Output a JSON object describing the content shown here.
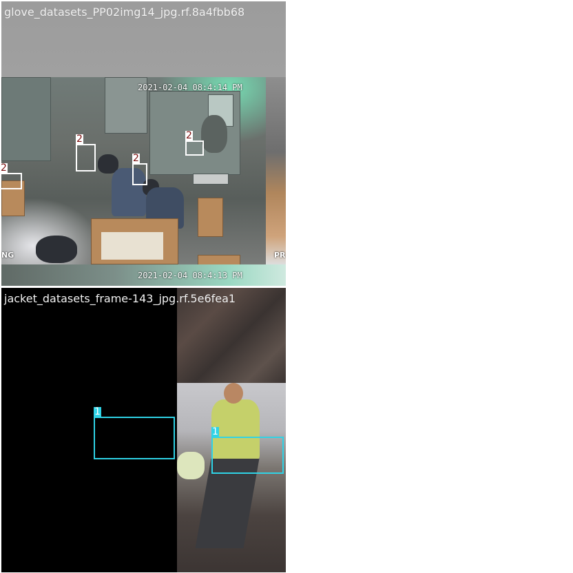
{
  "tiles": [
    {
      "title": "glove_datasets_PP02img14_jpg.rf.8a4fbb68",
      "overlay_timestamp_main": "2021-02-04 08:4:14 PM",
      "overlay_timestamp_bottom": "2021-02-04 08:4:13 PM",
      "corner_left_text": "NG",
      "corner_right_text": "PR",
      "detections": [
        {
          "class_id": "2",
          "color": "#ffffff"
        },
        {
          "class_id": "2",
          "color": "#ffffff"
        },
        {
          "class_id": "2",
          "color": "#ffffff"
        },
        {
          "class_id": "2",
          "color": "#ffffff"
        }
      ]
    },
    {
      "title": "jacket_datasets_frame-143_jpg.rf.5e6fea1",
      "detections": [
        {
          "class_id": "1",
          "color": "#2fd3e6"
        },
        {
          "class_id": "1",
          "color": "#2fd3e6"
        }
      ]
    }
  ]
}
